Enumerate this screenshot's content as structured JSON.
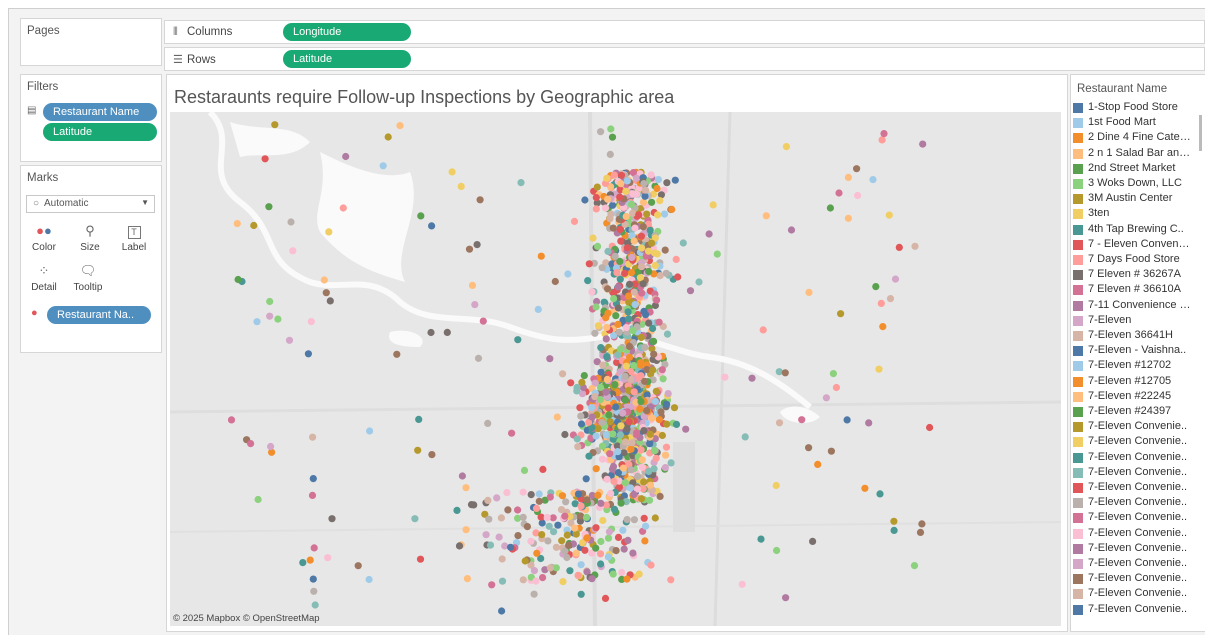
{
  "shelves": {
    "pages_label": "Pages",
    "columns_label": "Columns",
    "columns_pill": "Longitude",
    "rows_label": "Rows",
    "rows_pill": "Latitude"
  },
  "filters": {
    "title": "Filters",
    "items": [
      "Restaurant Name",
      "Latitude"
    ]
  },
  "marks": {
    "title": "Marks",
    "type": "Automatic",
    "buttons": [
      "Color",
      "Size",
      "Label",
      "Detail",
      "Tooltip"
    ],
    "color_field": "Restaurant Na.."
  },
  "view": {
    "title": "Restaraunts require Follow-up Inspections by Geographic area",
    "attribution": "© 2025 Mapbox © OpenStreetMap"
  },
  "legend": {
    "title": "Restaurant Name",
    "items": [
      {
        "label": "1-Stop Food Store",
        "color": "#4e79a7"
      },
      {
        "label": "1st Food Mart",
        "color": "#a0cbe8"
      },
      {
        "label": "2 Dine 4 Fine Cateri..",
        "color": "#f28e2b"
      },
      {
        "label": "2 n 1 Salad Bar and..",
        "color": "#ffbe7d"
      },
      {
        "label": "2nd Street Market",
        "color": "#59a14f"
      },
      {
        "label": "3 Woks Down, LLC",
        "color": "#8cd17d"
      },
      {
        "label": "3M Austin Center",
        "color": "#b6992d"
      },
      {
        "label": "3ten",
        "color": "#f1ce63"
      },
      {
        "label": "4th Tap Brewing C..",
        "color": "#499894"
      },
      {
        "label": "7 - Eleven Convenie..",
        "color": "#e15759"
      },
      {
        "label": "7 Days Food Store",
        "color": "#ff9d9a"
      },
      {
        "label": "7 Eleven # 36267A",
        "color": "#79706e"
      },
      {
        "label": "7 Eleven # 36610A",
        "color": "#d37295"
      },
      {
        "label": "7-11 Convenience S..",
        "color": "#b07aa1"
      },
      {
        "label": "7-Eleven",
        "color": "#d4a6c8"
      },
      {
        "label": "7-Eleven 36641H",
        "color": "#d7b5a6"
      },
      {
        "label": "7-Eleven - Vaishna..",
        "color": "#4e79a7"
      },
      {
        "label": "7-Eleven #12702",
        "color": "#a0cbe8"
      },
      {
        "label": "7-Eleven #12705",
        "color": "#f28e2b"
      },
      {
        "label": "7-Eleven #22245",
        "color": "#ffbe7d"
      },
      {
        "label": "7-Eleven #24397",
        "color": "#59a14f"
      },
      {
        "label": "7-Eleven Convenie..",
        "color": "#b6992d"
      },
      {
        "label": "7-Eleven Convenie..",
        "color": "#f1ce63"
      },
      {
        "label": "7-Eleven Convenie..",
        "color": "#499894"
      },
      {
        "label": "7-Eleven Convenie..",
        "color": "#86bcb6"
      },
      {
        "label": "7-Eleven Convenie..",
        "color": "#e15759"
      },
      {
        "label": "7-Eleven Convenie..",
        "color": "#bab0ac"
      },
      {
        "label": "7-Eleven Convenie..",
        "color": "#d37295"
      },
      {
        "label": "7-Eleven Convenie..",
        "color": "#fabfd2"
      },
      {
        "label": "7-Eleven Convenie..",
        "color": "#b07aa1"
      },
      {
        "label": "7-Eleven Convenie..",
        "color": "#d4a6c8"
      },
      {
        "label": "7-Eleven Convenie..",
        "color": "#9d7660"
      },
      {
        "label": "7-Eleven Convenie..",
        "color": "#d7b5a6"
      },
      {
        "label": "7-Eleven Convenie..",
        "color": "#4e79a7"
      }
    ]
  },
  "palette": [
    "#4e79a7",
    "#a0cbe8",
    "#f28e2b",
    "#ffbe7d",
    "#59a14f",
    "#8cd17d",
    "#b6992d",
    "#f1ce63",
    "#499894",
    "#86bcb6",
    "#e15759",
    "#ff9d9a",
    "#79706e",
    "#bab0ac",
    "#d37295",
    "#fabfd2",
    "#b07aa1",
    "#d4a6c8",
    "#9d7660",
    "#d7b5a6"
  ]
}
